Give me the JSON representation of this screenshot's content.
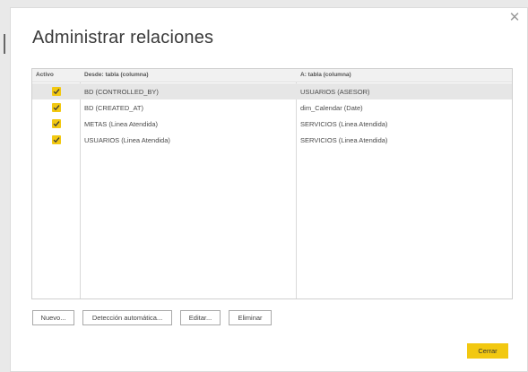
{
  "dialog": {
    "title": "Administrar relaciones",
    "close_icon": "close-icon"
  },
  "grid": {
    "headers": {
      "active": "Activo",
      "from": "Desde: tabla (columna)",
      "to": "A: tabla (columna)"
    },
    "rows": [
      {
        "active": true,
        "from": "BD (CONTROLLED_BY)",
        "to": "USUARIOS (ASESOR)",
        "selected": true
      },
      {
        "active": true,
        "from": "BD (CREATED_AT)",
        "to": "dim_Calendar (Date)",
        "selected": false
      },
      {
        "active": true,
        "from": "METAS (Linea Atendida)",
        "to": "SERVICIOS (Linea Atendida)",
        "selected": false
      },
      {
        "active": true,
        "from": "USUARIOS (Linea Atendida)",
        "to": "SERVICIOS (Linea Atendida)",
        "selected": false
      }
    ]
  },
  "buttons": {
    "new": "Nuevo...",
    "autodetect": "Detección automática...",
    "edit": "Editar...",
    "delete": "Eliminar",
    "close": "Cerrar"
  },
  "colors": {
    "accent": "#f2c811",
    "selected_row": "#e6e6e6"
  }
}
